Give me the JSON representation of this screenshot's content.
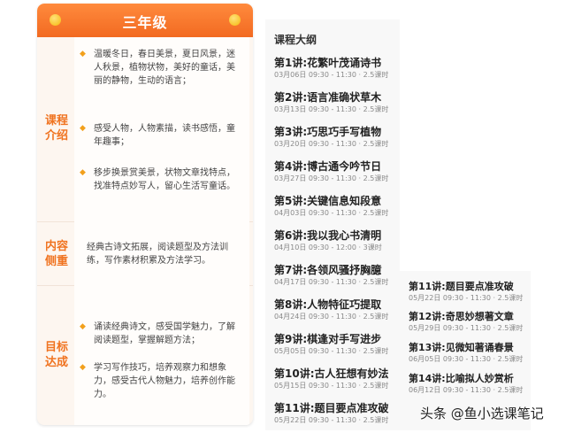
{
  "card": {
    "title": "三年级",
    "sections": [
      {
        "label": "课程介绍",
        "items": [
          "温暖冬日，春日美景，夏日风景，迷人秋景，植物状物，美好的童话，美丽的静物，生动的语言；",
          "感受人物，人物素描，读书感悟，童年趣事；",
          "移步换景赏美景，状物文章找特点，找准特点妙写人，留心生活写童话。"
        ]
      },
      {
        "label": "内容侧重",
        "items": [
          "经典古诗文拓展，阅读题型及方法训练，写作素材积累及方法学习。"
        ]
      },
      {
        "label": "目标达成",
        "items": [
          "诵读经典诗文，感受国学魅力，了解阅读题型，掌握解题方法；",
          "学习写作技巧，培养观察力和想象力，感受古代人物魅力，培养创作能力。"
        ]
      }
    ]
  },
  "outline": {
    "title": "课程大纲",
    "lessons": [
      {
        "title": "第1讲:花繁叶茂诵诗书",
        "meta": "03月06日 09:30 - 11:30 · 2.5课时"
      },
      {
        "title": "第2讲:语言准确状草木",
        "meta": "03月13日 09:30 - 11:30 · 2.5课时"
      },
      {
        "title": "第3讲:巧思巧手写植物",
        "meta": "03月20日 09:30 - 11:30 · 2.5课时"
      },
      {
        "title": "第4讲:博古通今吟节日",
        "meta": "03月27日 09:30 - 11:30 · 2.5课时"
      },
      {
        "title": "第5讲:关键信息知段意",
        "meta": "04月03日 09:30 - 11:30 · 2.5课时"
      },
      {
        "title": "第6讲:我以我心书清明",
        "meta": "04月10日 09:30 - 12:00 · 3课时"
      },
      {
        "title": "第7讲:各领风骚抒胸臆",
        "meta": "04月17日 09:30 - 11:30 · 2.5课时"
      },
      {
        "title": "第8讲:人物特征巧提取",
        "meta": "04月24日 09:30 - 11:30 · 2.5课时"
      },
      {
        "title": "第9讲:棋逢对手写进步",
        "meta": "05月05日 09:30 - 11:30 · 2.5课时"
      },
      {
        "title": "第10讲:古人狂想有妙法",
        "meta": "05月15日 09:30 - 11:30 · 2.5课时"
      },
      {
        "title": "第11讲:题目要点准攻破",
        "meta": "05月22日 09:30 - 11:30 · 2.5课时"
      }
    ]
  },
  "outline_continued": {
    "lessons": [
      {
        "title": "第11讲:题目要点准攻破",
        "meta": "05月22日 09:30 - 11:30 · 2.5课时"
      },
      {
        "title": "第12讲:奇思妙想著文章",
        "meta": "05月29日 09:30 - 11:30 · 2.5课时"
      },
      {
        "title": "第13讲:见微知著诵春景",
        "meta": "06月05日 09:30 - 11:30 · 2.5课时"
      },
      {
        "title": "第14讲:比喻拟人妙赏析",
        "meta": "06月12日 09:30 - 11:30 · 2.5课时"
      }
    ]
  },
  "watermark": "头条 @鱼小选课笔记"
}
